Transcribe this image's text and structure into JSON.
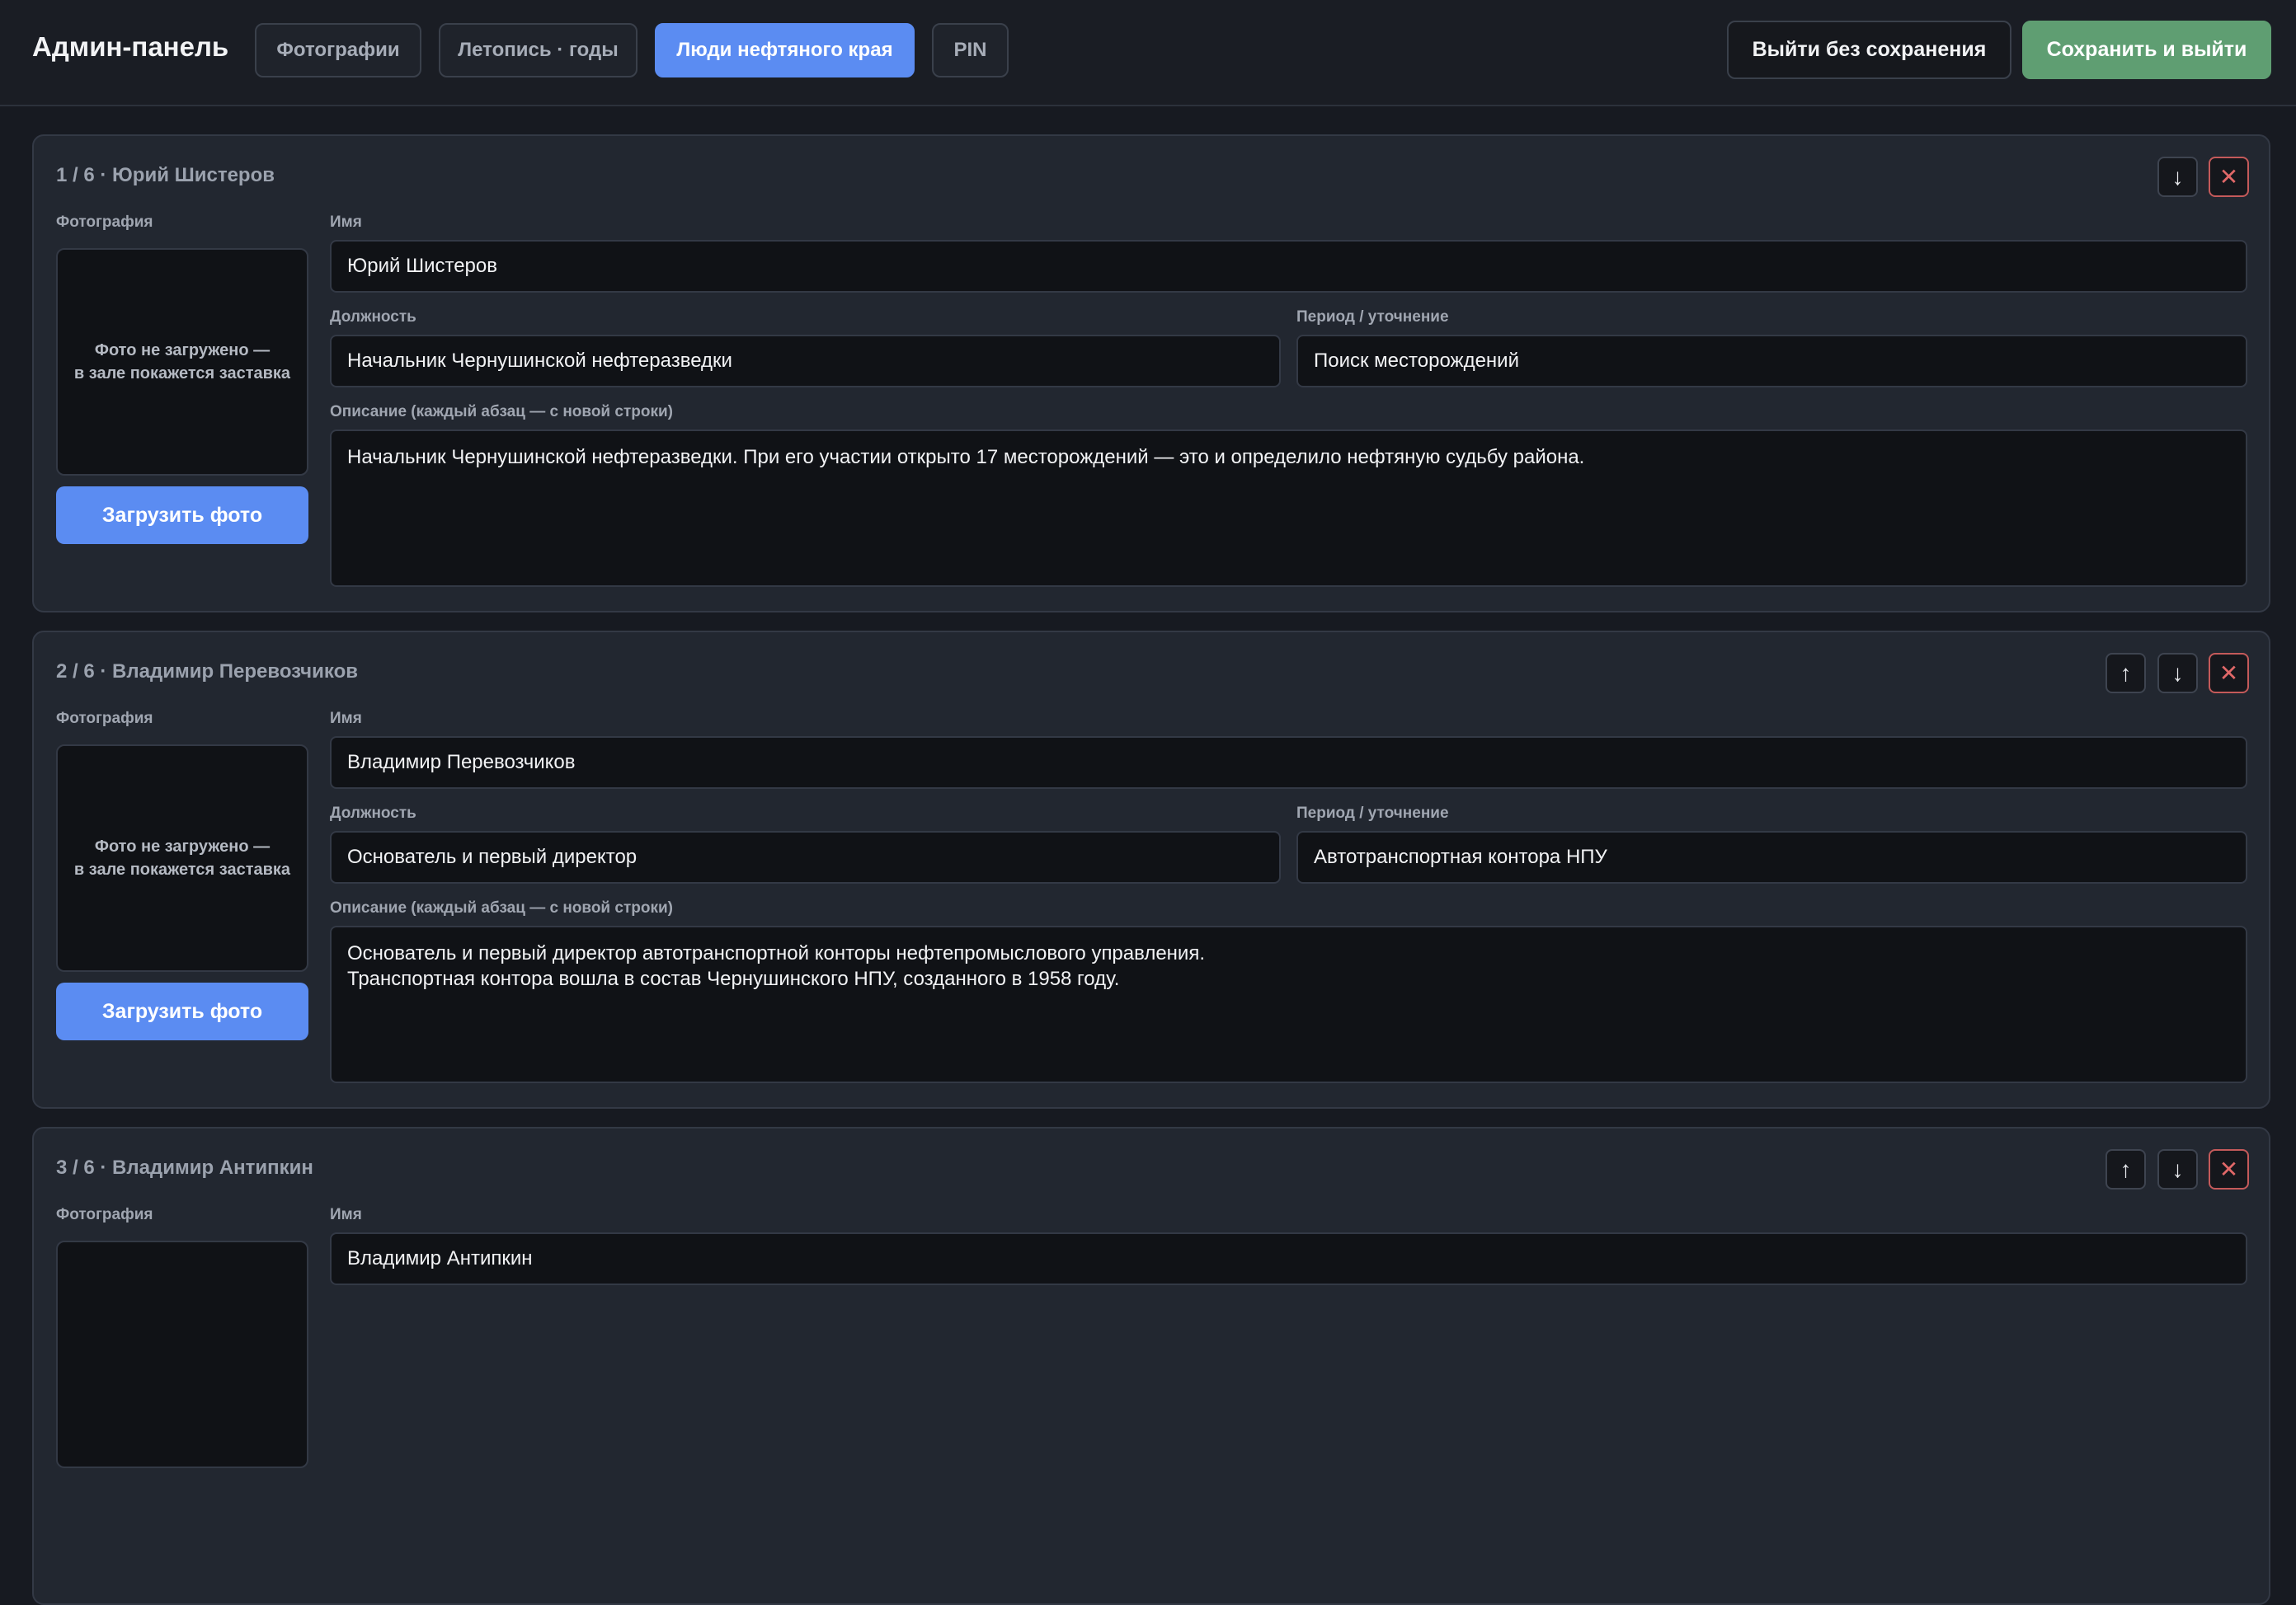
{
  "header": {
    "title": "Админ-панель",
    "tabs": [
      {
        "label": "Фотографии"
      },
      {
        "label": "Летопись · годы"
      },
      {
        "label": "Люди нефтяного края"
      },
      {
        "label": "PIN"
      }
    ],
    "exit_label": "Выйти без сохранения",
    "save_label": "Сохранить и выйти"
  },
  "labels": {
    "photo": "Фотография",
    "name": "Имя",
    "position": "Должность",
    "period": "Период / уточнение",
    "description": "Описание (каждый абзац — с новой строки)",
    "no_photo": "Фото не загружено —\nв зале покажется заставка",
    "upload": "Загрузить фото"
  },
  "icons": {
    "up": "arrow-up-icon",
    "down": "arrow-down-icon",
    "delete": "close-icon"
  },
  "colors": {
    "accent": "#5b8cf2",
    "save": "#5f9e72",
    "danger": "#e06868"
  },
  "people": [
    {
      "heading": "1 / 6 · Юрий Шистеров",
      "name": "Юрий Шистеров",
      "position": "Начальник Чернушинской нефтеразведки",
      "period": "Поиск месторождений",
      "description": "Начальник Чернушинской нефтеразведки. При его участии открыто 17 месторождений — это и определило нефтяную судьбу района."
    },
    {
      "heading": "2 / 6 · Владимир Перевозчиков",
      "name": "Владимир Перевозчиков",
      "position": "Основатель и первый директор",
      "period": "Автотранспортная контора НПУ",
      "description": "Основатель и первый директор автотранспортной конторы нефтепромыслового управления.\nТранспортная контора вошла в состав Чернушинского НПУ, созданного в 1958 году."
    },
    {
      "heading": "3 / 6 · Владимир Антипкин",
      "name": "Владимир Антипкин",
      "position": "",
      "period": "",
      "description": ""
    }
  ]
}
